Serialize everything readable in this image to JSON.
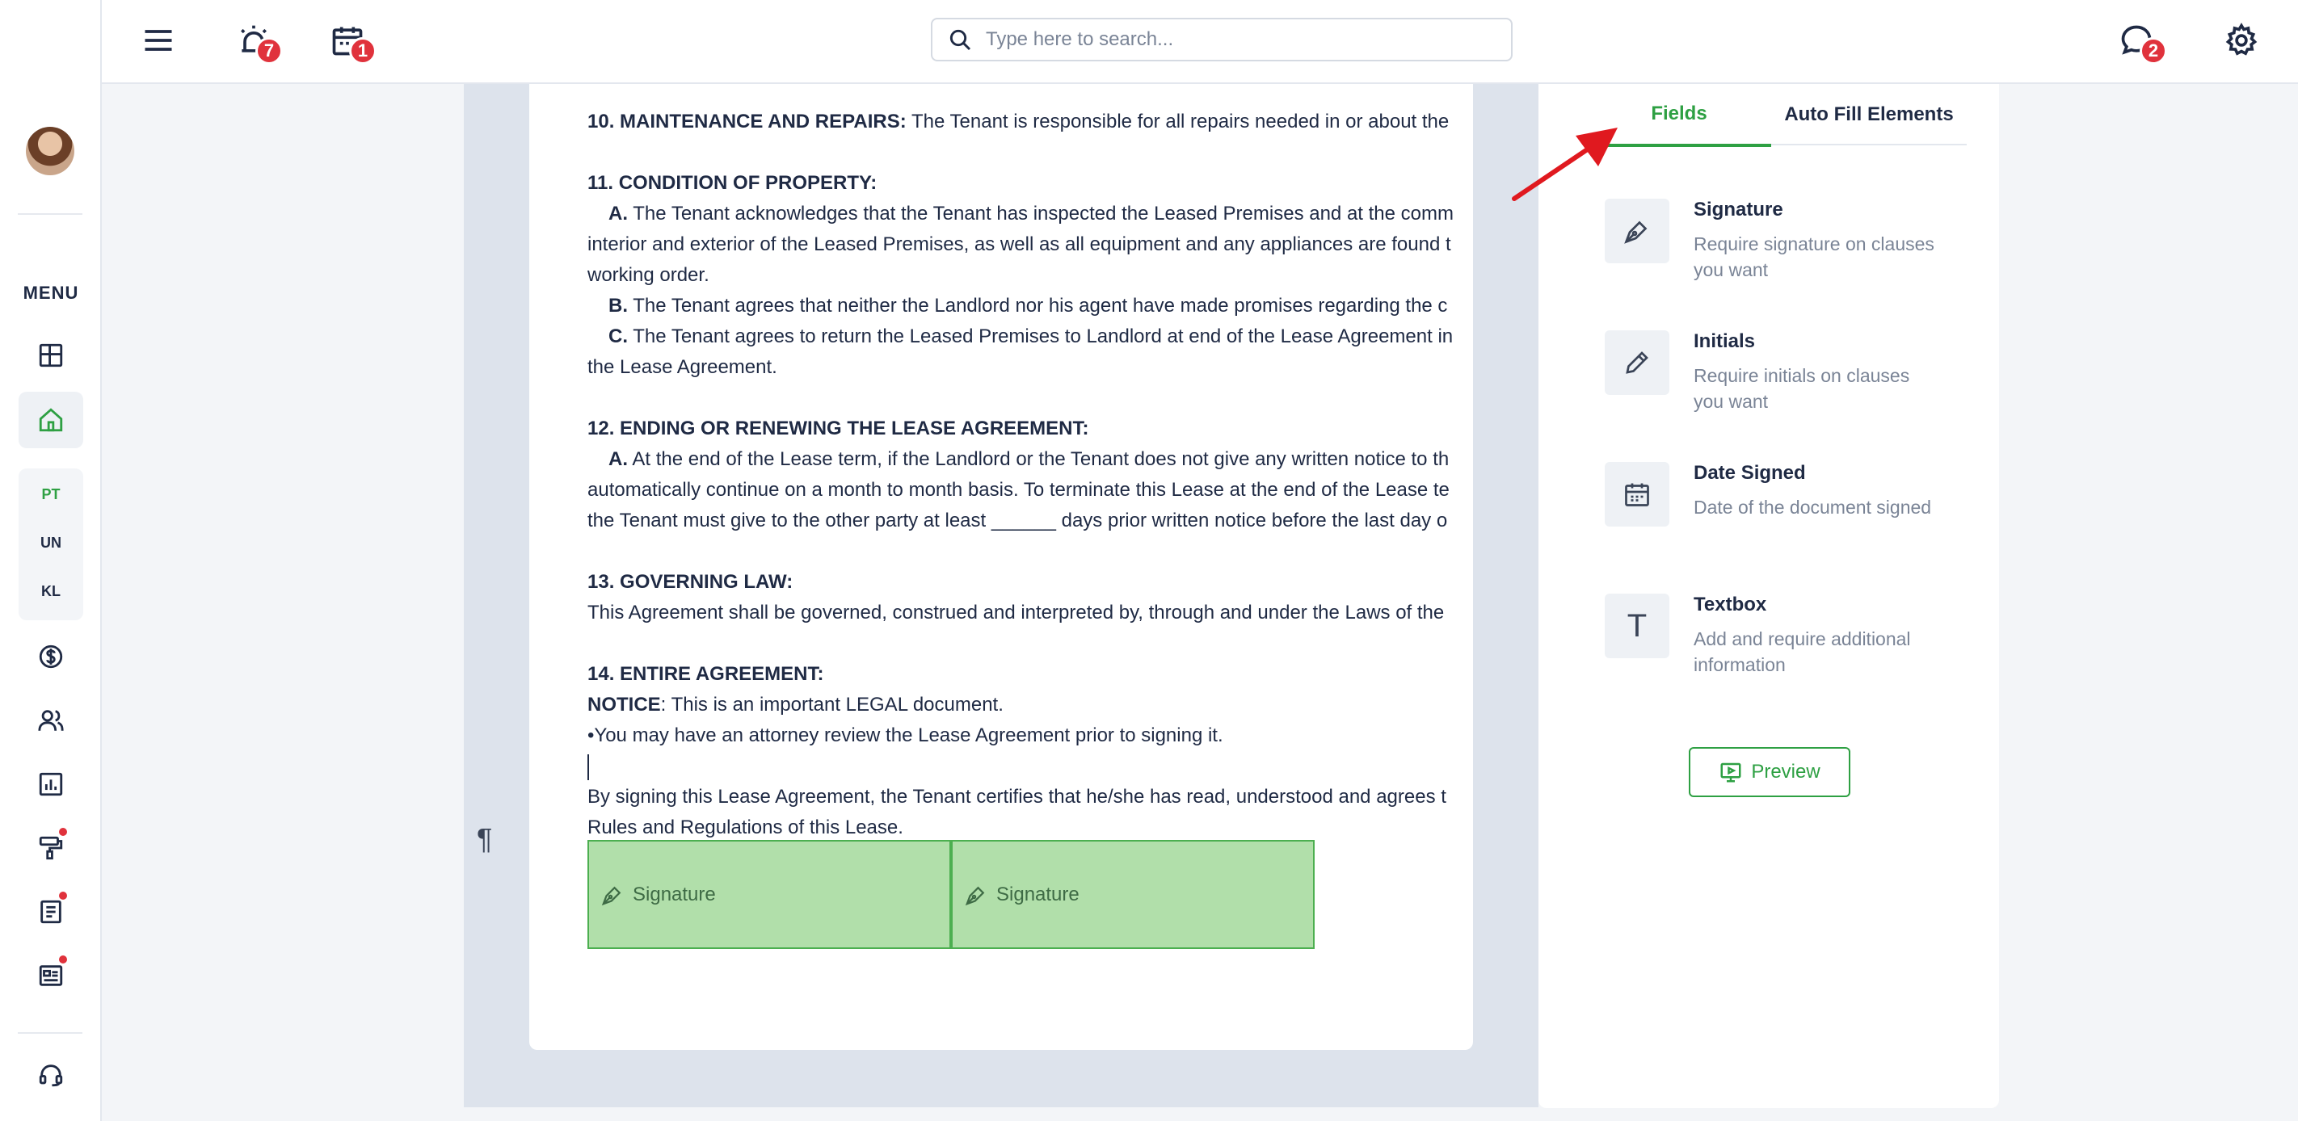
{
  "header": {
    "search_placeholder": "Type here to search...",
    "alerts_count": "7",
    "calendar_count": "1",
    "messages_count": "2"
  },
  "sidebar": {
    "menu_label": "MENU",
    "properties": [
      "PT",
      "UN",
      "KL"
    ],
    "icons": [
      "dashboard-icon",
      "home-icon",
      "dollar-icon",
      "users-icon",
      "chart-icon",
      "paint-roller-icon",
      "document-icon",
      "news-icon",
      "headset-icon"
    ]
  },
  "document": {
    "s10_heading": "10. MAINTENANCE AND REPAIRS:",
    "s10_text": " The Tenant is responsible for all repairs needed in or about the",
    "s11_heading": "11. CONDITION OF PROPERTY:",
    "s11_a_label": "A.",
    "s11_a_text": " The Tenant acknowledges that the Tenant has inspected the Leased Premises and at the comm",
    "s11_a_line2": "interior and exterior of the Leased Premises, as well as all equipment and any appliances are found t",
    "s11_a_line3": "working order.",
    "s11_b_label": "B.",
    "s11_b_text": " The Tenant agrees that neither the Landlord nor his agent have made promises regarding the c",
    "s11_c_label": "C.",
    "s11_c_text": " The Tenant agrees to return the Leased Premises to Landlord at end of the Lease Agreement in",
    "s11_c_line2": "the Lease Agreement.",
    "s12_heading": "12. ENDING OR RENEWING THE LEASE AGREEMENT:",
    "s12_a_label": "A.",
    "s12_a_text": " At the end of the Lease term, if the Landlord or the Tenant does not give any written notice to th",
    "s12_a_line2": "automatically continue on a month to month basis. To terminate this Lease at the end of the Lease te",
    "s12_a_line3": "the Tenant must give to the other party at least ______ days prior written notice before the last day o",
    "s13_heading": "13. GOVERNING LAW:",
    "s13_text": "This Agreement shall be governed, construed and interpreted by, through and under the Laws of the",
    "s14_heading": "14. ENTIRE AGREEMENT:",
    "notice_label": "NOTICE",
    "notice_text": ": This is an important LEGAL document.",
    "bullet_text": "•You may have an attorney review the Lease Agreement prior to signing it.",
    "closing_line1": "By signing this Lease Agreement, the Tenant certifies that he/she has read, understood and agrees t",
    "closing_line2": "Rules and Regulations of this Lease.",
    "pilcrow": "¶",
    "signature_boxes": [
      "Signature",
      "Signature"
    ]
  },
  "panel": {
    "tabs": [
      "Fields",
      "Auto Fill Elements"
    ],
    "active_tab": "Fields",
    "fields": [
      {
        "title": "Signature",
        "desc": "Require signature on clauses you want",
        "icon": "pen-nib-icon"
      },
      {
        "title": "Initials",
        "desc": "Require initials on clauses you want",
        "icon": "pencil-icon"
      },
      {
        "title": "Date Signed",
        "desc": "Date of the document signed",
        "icon": "calendar-icon"
      },
      {
        "title": "Textbox",
        "desc": "Add and require additional information",
        "icon": "text-t-icon",
        "glyph": "T"
      }
    ],
    "preview_label": "Preview"
  },
  "colors": {
    "accent": "#2ea043",
    "badge": "#e0323c",
    "signature_fill": "#b1dfaa",
    "annotation_arrow": "#e0191f"
  }
}
